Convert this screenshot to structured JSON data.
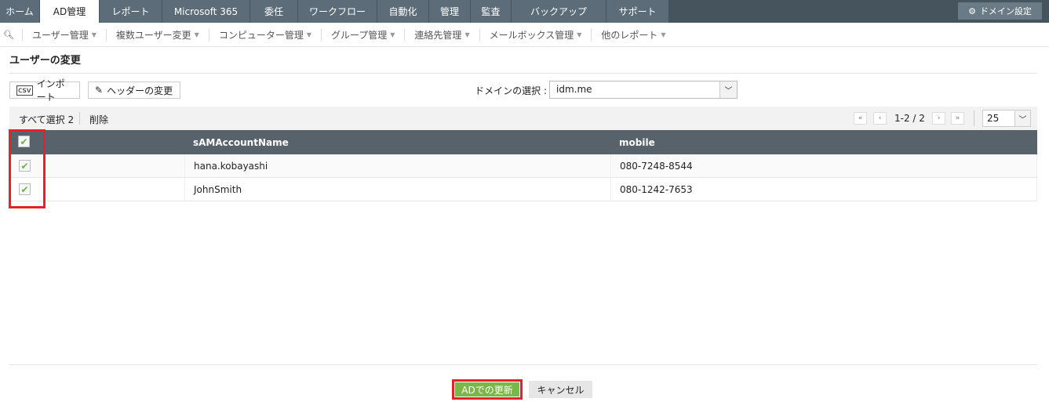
{
  "tabs": [
    {
      "label": "ホーム"
    },
    {
      "label": "AD管理"
    },
    {
      "label": "レポート"
    },
    {
      "label": "Microsoft 365"
    },
    {
      "label": "委任"
    },
    {
      "label": "ワークフロー"
    },
    {
      "label": "自動化"
    },
    {
      "label": "管理"
    },
    {
      "label": "監査"
    },
    {
      "label": "バックアップ"
    },
    {
      "label": "サポート"
    }
  ],
  "domain_settings": "ドメイン設定",
  "subnav": [
    {
      "label": "ユーザー管理"
    },
    {
      "label": "複数ユーザー変更"
    },
    {
      "label": "コンピューター管理"
    },
    {
      "label": "グループ管理"
    },
    {
      "label": "連絡先管理"
    },
    {
      "label": "メールボックス管理"
    },
    {
      "label": "他のレポート"
    }
  ],
  "page_title": "ユーザーの変更",
  "import_label": "インポート",
  "header_change_label": "ヘッダーの変更",
  "domain_label": "ドメインの選択 :",
  "domain_value": "idm.me",
  "select_all": "すべて選択 2",
  "delete_label": "削除",
  "pagination": {
    "range": "1-2 / 2",
    "page_size": "25"
  },
  "columns": [
    "sAMAccountName",
    "mobile"
  ],
  "rows": [
    {
      "sam": "hana.kobayashi",
      "mobile": "080-7248-8544"
    },
    {
      "sam": "JohnSmith",
      "mobile": "080-1242-7653"
    }
  ],
  "update_label": "ADでの更新",
  "cancel_label": "キャンセル"
}
